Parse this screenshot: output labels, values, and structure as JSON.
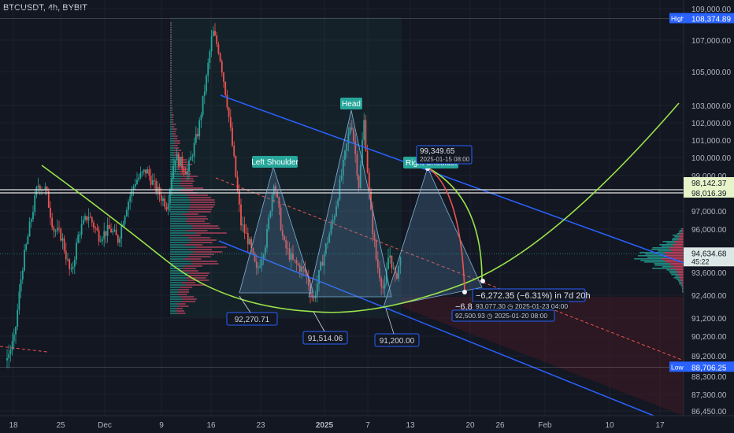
{
  "header": {
    "symbol": "BTCUSDT",
    "interval": "4h",
    "exchange": "BYBIT"
  },
  "chart_data": {
    "type": "candlestick",
    "ylim": [
      86000,
      109400
    ],
    "y_ticks": [
      "109,000.00",
      "107,000.00",
      "105,000.00",
      "103,000.00",
      "102,000.00",
      "101,000.00",
      "100,000.00",
      "99,000.00",
      "97,000.00",
      "96,000.00",
      "93,600.00",
      "92,400.00",
      "91,200.00",
      "90,200.00",
      "89,200.00",
      "88,300.00",
      "87,300.00",
      "86,450.00"
    ],
    "x_ticks": [
      "18",
      "25",
      "Dec",
      "9",
      "16",
      "23",
      "2025",
      "7",
      "13",
      "20",
      "26",
      "Feb",
      "10",
      "17"
    ],
    "price_labels": [
      {
        "kind": "high",
        "tag": "High",
        "value": 108374.89,
        "text": "108,374.89"
      },
      {
        "kind": "line",
        "value": 98142.37,
        "text": "98,142.37"
      },
      {
        "kind": "line",
        "value": 98016.39,
        "text": "98,016.39"
      },
      {
        "kind": "last",
        "value": 94634.68,
        "text": "94,634.68",
        "sub": "45:22"
      },
      {
        "kind": "low",
        "tag": "Low",
        "value": 88706.25,
        "text": "88,706.25"
      }
    ],
    "pattern_labels": {
      "left_shoulder": "Left Shoulder",
      "head": "Head",
      "right_shoulder": "Right Shoulder"
    },
    "lows": [
      {
        "text": "92,270.71",
        "value": 92270.71
      },
      {
        "text": "91,514.06",
        "value": 91514.06
      },
      {
        "text": "91,200.00",
        "value": 91200.0
      }
    ],
    "projection": {
      "top_price": "99,349.65",
      "top_date": "2025-01-15 08:00",
      "measure": "−6,272.35 (−6.31%) in 7d 20h",
      "measure_partial": "−6,8",
      "p1": "93,077.30 ◷ 2025-01-23  04:00",
      "p2": "92,500.93 ◷ 2025-01-20  08:00"
    },
    "colors": {
      "up": "#26a69a",
      "down": "#ef5350",
      "blue": "#2962ff",
      "green": "#9be34a",
      "bg": "#131722",
      "volume_profile": "#e44b6b"
    }
  }
}
